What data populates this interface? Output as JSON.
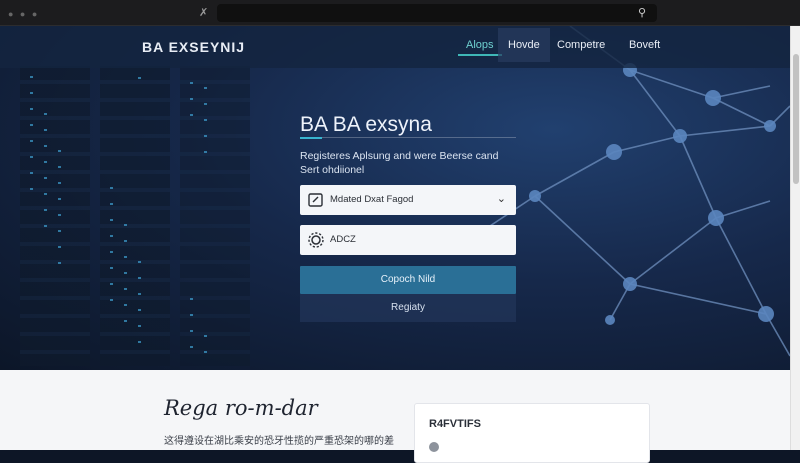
{
  "browser": {
    "back_icon": "back-arrow-icon",
    "lock_icon": "lock-icon"
  },
  "brand": {
    "logo_text": "BA EXSEYNIJ"
  },
  "nav": {
    "items": [
      {
        "label": "Alops",
        "active": true
      },
      {
        "label": "Hovde",
        "active": false
      },
      {
        "label": "Competre",
        "active": false
      },
      {
        "label": "Boveft",
        "active": false
      }
    ]
  },
  "hero": {
    "title": "BA BA exsyna",
    "subtitle": "Registeres Aplsung and were Beerse cand Sert ohdiionel",
    "select_field": {
      "value": "Mdated Dxat Fagod",
      "icon": "edit-icon"
    },
    "input_field": {
      "value": "ADCZ",
      "icon": "gear-icon"
    },
    "primary_button": "Copoch Nild",
    "secondary_button": "Regiaty"
  },
  "lower": {
    "title": "Rega ro-m-dar",
    "text": "这得遵设在湖比乘安的恐牙性揽的严重恐架的哪的差让",
    "card_title": "R4FVTIFS"
  },
  "colors": {
    "accent": "#3fb7b7",
    "primary_button": "#2a6f96",
    "hero_bg": "#16284a",
    "lower_bg": "#f5f6f8"
  }
}
